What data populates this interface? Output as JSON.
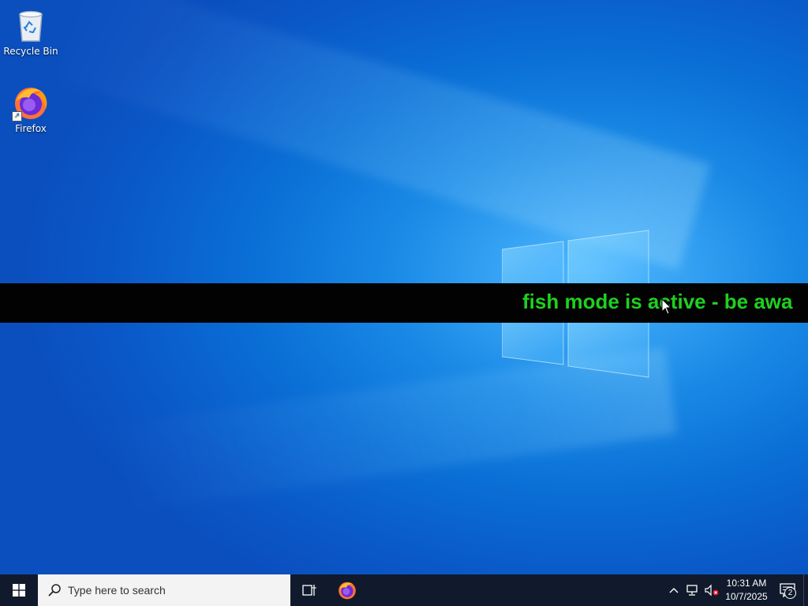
{
  "desktop": {
    "icons": [
      {
        "label": "Recycle Bin",
        "icon": "recycle-bin-icon"
      },
      {
        "label": "Firefox",
        "icon": "firefox-icon"
      }
    ]
  },
  "banner": {
    "text": "fish mode is active - be awa",
    "color": "#1fd01f"
  },
  "taskbar": {
    "search_placeholder": "Type here to search",
    "clock_time": "10:31 AM",
    "clock_date": "10/7/2025",
    "notification_count": "2"
  },
  "colors": {
    "accent": "#0a6fd6",
    "taskbar": "#101a2c"
  }
}
